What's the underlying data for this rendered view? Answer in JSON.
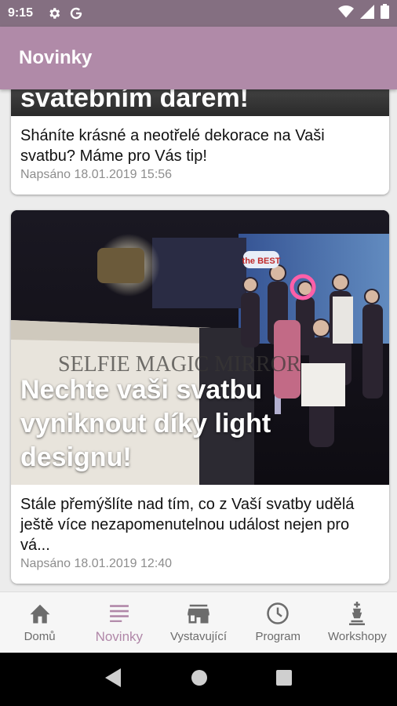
{
  "status_bar": {
    "time": "9:15",
    "icons": [
      "settings-icon",
      "google-icon",
      "wifi-icon",
      "signal-icon",
      "battery-icon"
    ]
  },
  "app_bar": {
    "title": "Novinky"
  },
  "colors": {
    "status_bar": "#846f81",
    "app_bar": "#b08aa8",
    "accent": "#b087a8",
    "inactive": "#6c6c6c"
  },
  "articles": [
    {
      "headline": "svatebním darem!",
      "description": "Sháníte krásné a neotřelé dekorace na Vaši svatbu? Máme pro Vás tip!",
      "date": "Napsáno 18.01.2019 15:56"
    },
    {
      "headline": "Nechte vaši svatbu vyniknout díky light designu!",
      "description": "Stále přemýšlíte nad tím, co z Vaší svatby udělá ještě více nezapomenutelnou událost nejen pro vá...",
      "date": "Napsáno 18.01.2019 12:40",
      "image_sign_text": "SELFIE MAGIC MIRROR",
      "image_prop_text": "the BEST"
    }
  ],
  "bottom_nav": {
    "items": [
      {
        "label": "Domů",
        "icon": "home-icon",
        "active": false
      },
      {
        "label": "Novinky",
        "icon": "news-icon",
        "active": true
      },
      {
        "label": "Vystavující",
        "icon": "store-icon",
        "active": false
      },
      {
        "label": "Program",
        "icon": "clock-icon",
        "active": false
      },
      {
        "label": "Workshopy",
        "icon": "chess-icon",
        "active": false
      }
    ]
  },
  "system_nav": [
    "back-icon",
    "home-circle-icon",
    "recents-icon"
  ]
}
